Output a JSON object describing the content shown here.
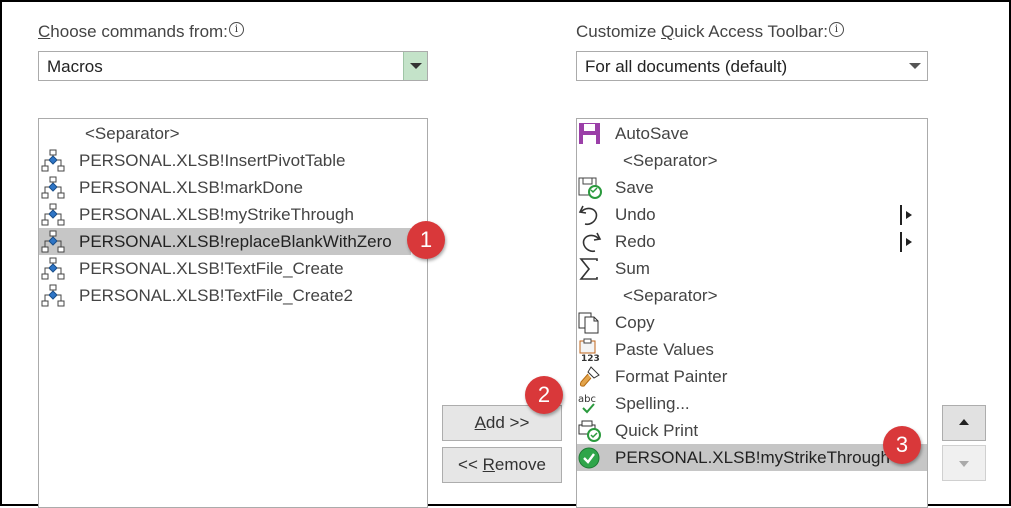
{
  "left": {
    "label_prefix": "C",
    "label_rest": "hoose commands from:",
    "combo_value": "Macros",
    "items": [
      {
        "label": "<Separator>",
        "icon": "none"
      },
      {
        "label": "PERSONAL.XLSB!InsertPivotTable",
        "icon": "macro-icon"
      },
      {
        "label": "PERSONAL.XLSB!markDone",
        "icon": "macro-icon"
      },
      {
        "label": "PERSONAL.XLSB!myStrikeThrough",
        "icon": "macro-icon"
      },
      {
        "label": "PERSONAL.XLSB!replaceBlankWithZero",
        "icon": "macro-icon",
        "selected": true
      },
      {
        "label": "PERSONAL.XLSB!TextFile_Create",
        "icon": "macro-icon"
      },
      {
        "label": "PERSONAL.XLSB!TextFile_Create2",
        "icon": "macro-icon"
      }
    ]
  },
  "right": {
    "label_prefix": "Customize ",
    "label_ul": "Q",
    "label_rest": "uick Access Toolbar:",
    "combo_value": "For all documents (default)",
    "items": [
      {
        "label": "AutoSave",
        "icon": "autosave-icon"
      },
      {
        "label": "<Separator>",
        "icon": "none"
      },
      {
        "label": "Save",
        "icon": "save-icon"
      },
      {
        "label": "Undo",
        "icon": "undo-icon"
      },
      {
        "label": "Redo",
        "icon": "redo-icon"
      },
      {
        "label": "Sum",
        "icon": "sum-icon"
      },
      {
        "label": "<Separator>",
        "icon": "none"
      },
      {
        "label": "Copy",
        "icon": "copy-icon"
      },
      {
        "label": "Paste Values",
        "icon": "paste-values-icon"
      },
      {
        "label": "Format Painter",
        "icon": "format-painter-icon"
      },
      {
        "label": "Spelling...",
        "icon": "spelling-icon"
      },
      {
        "label": "Quick Print",
        "icon": "quick-print-icon"
      },
      {
        "label": "PERSONAL.XLSB!myStrikeThrough",
        "icon": "macro-check-icon",
        "selected": true
      }
    ]
  },
  "info_glyph": "i",
  "buttons": {
    "add_ul": "A",
    "add_rest": "dd >>",
    "remove_prefix": "<< ",
    "remove_ul": "R",
    "remove_rest": "emove"
  },
  "badges": [
    "1",
    "2",
    "3"
  ],
  "colors": {
    "badge": "#d9383a",
    "selection": "#c6c6c6",
    "combo_dropdown": "#c4e3c9"
  }
}
